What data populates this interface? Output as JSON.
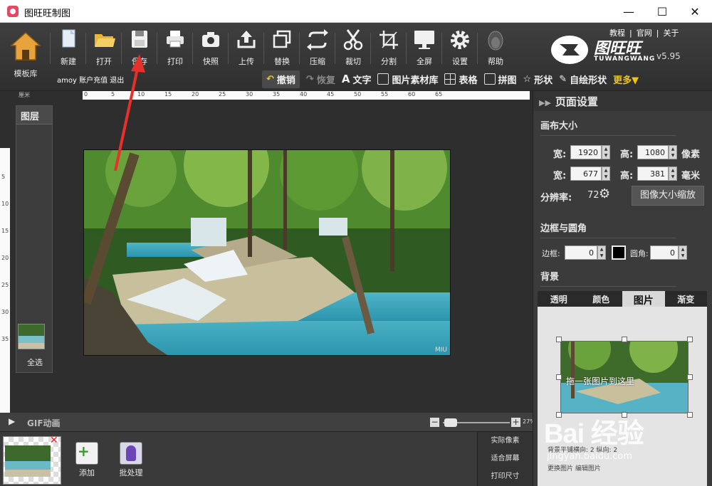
{
  "window": {
    "title": "图旺旺制图",
    "minimize": "—",
    "maximize": "☐",
    "close": "✕"
  },
  "toolbar": {
    "home_label": "模板库",
    "buttons": [
      {
        "label": "新建",
        "icon": "new-file-icon"
      },
      {
        "label": "打开",
        "icon": "folder-open-icon"
      },
      {
        "label": "保存",
        "icon": "save-icon"
      },
      {
        "label": "打印",
        "icon": "printer-icon"
      },
      {
        "label": "快照",
        "icon": "camera-icon"
      },
      {
        "label": "上传",
        "icon": "upload-icon"
      },
      {
        "label": "替换",
        "icon": "replace-icon"
      },
      {
        "label": "压缩",
        "icon": "compress-icon"
      },
      {
        "label": "裁切",
        "icon": "scissors-icon"
      },
      {
        "label": "分割",
        "icon": "crop-split-icon"
      },
      {
        "label": "全屏",
        "icon": "monitor-icon"
      },
      {
        "label": "设置",
        "icon": "gear-icon"
      },
      {
        "label": "帮助",
        "icon": "help-penguin-icon"
      }
    ],
    "user": "amoy",
    "account_recharge": "账户充值",
    "logout": "退出",
    "top_links": [
      "教程",
      "官网",
      "关于"
    ],
    "logo_cn": "图旺旺",
    "logo_en": "TUWANGWANG",
    "version": "v5.95"
  },
  "subbar": {
    "undo": "撤销",
    "redo": "恢复",
    "text": "文字",
    "image_library": "图片素材库",
    "table": "表格",
    "collage": "拼图",
    "shape": "形状",
    "custom_shape": "自绘形状",
    "more": "更多▼"
  },
  "workarea": {
    "ruler_unit": "厘米",
    "ruler_top_numbers": [
      "0",
      "5",
      "10",
      "15",
      "20",
      "25",
      "30",
      "35",
      "40",
      "45",
      "50",
      "55",
      "60",
      "65"
    ],
    "ruler_left_numbers": [
      "5",
      "10",
      "15",
      "20",
      "25",
      "30",
      "35"
    ],
    "layers_title": "图层",
    "select_all": "全选",
    "photo_watermark": "MIU",
    "gif_label": "GIF动画",
    "zoom_value": "27%"
  },
  "right_panel": {
    "title": "页面设置",
    "canvas_size": "画布大小",
    "width_label": "宽:",
    "height_label": "高:",
    "width_px": "1920",
    "height_px": "1080",
    "px_unit": "像素",
    "width_mm": "677",
    "height_mm": "381",
    "mm_unit": "毫米",
    "resolution_label": "分辨率:",
    "resolution_value": "72",
    "resize_button": "图像大小缩放",
    "border_section": "边框与圆角",
    "border_label": "边框:",
    "border_value": "0",
    "radius_label": "圆角:",
    "radius_value": "0",
    "background_section": "背景",
    "bg_tabs": [
      "透明",
      "颜色",
      "图片",
      "渐变"
    ],
    "bg_hint": "拖一张图片到这里",
    "bg_bottom": "背景平铺横向:  2  纵向:  2",
    "bg_bottom_buttons": "更换图片  编辑图片"
  },
  "bottom": {
    "add_label": "添加",
    "batch_label": "批处理",
    "view_actual": "实际像素",
    "view_fit": "适合屏幕",
    "view_print": "打印尺寸"
  },
  "watermark": {
    "text": "Bai  经验",
    "url": "jingyan.baidu.com"
  }
}
